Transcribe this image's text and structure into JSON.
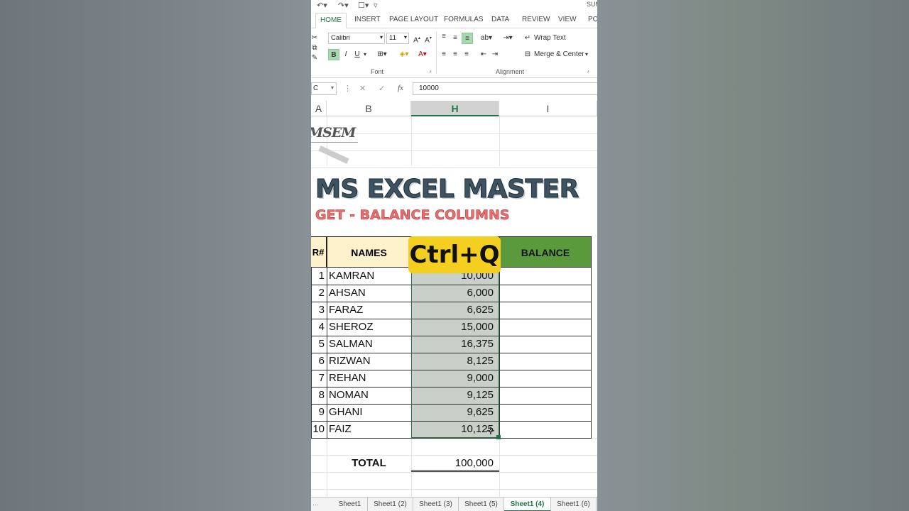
{
  "ribbon": {
    "tabs": [
      "HOME",
      "INSERT",
      "PAGE LAYOUT",
      "FORMULAS",
      "DATA",
      "REVIEW",
      "VIEW",
      "PO"
    ],
    "title_fragment": "SUM",
    "font_name": "Calibri",
    "font_size": "11",
    "wrap_text": "Wrap Text",
    "merge_center": "Merge & Center",
    "group_font": "Font",
    "group_alignment": "Alignment"
  },
  "formula_bar": {
    "name_box": "C",
    "fx": "fx",
    "value": "10000"
  },
  "columns": [
    "A",
    "B",
    "H",
    "I"
  ],
  "heading": {
    "logo_text": "MSEM",
    "title": "MS EXCEL MASTER",
    "subtitle": "GET - BALANCE COLUMNS"
  },
  "table": {
    "headers": {
      "sr": "R#",
      "names": "NAMES",
      "amount": "",
      "balance": "BALANCE"
    },
    "rows": [
      {
        "sr": "1",
        "name": "KAMRAN",
        "amount": "10,000"
      },
      {
        "sr": "2",
        "name": "AHSAN",
        "amount": "6,000"
      },
      {
        "sr": "3",
        "name": "FARAZ",
        "amount": "6,625"
      },
      {
        "sr": "4",
        "name": "SHEROZ",
        "amount": "15,000"
      },
      {
        "sr": "5",
        "name": "SALMAN",
        "amount": "16,375"
      },
      {
        "sr": "6",
        "name": "RIZWAN",
        "amount": "8,125"
      },
      {
        "sr": "7",
        "name": "REHAN",
        "amount": "9,000"
      },
      {
        "sr": "8",
        "name": "NOMAN",
        "amount": "9,125"
      },
      {
        "sr": "9",
        "name": "GHANI",
        "amount": "9,625"
      },
      {
        "sr": "10",
        "name": "FAIZ",
        "amount": "10,125"
      }
    ],
    "total_label": "TOTAL",
    "total_value": "100,000"
  },
  "shortcut_badge": "Ctrl+Q",
  "sheet_tabs": [
    "Sheet1",
    "Sheet1 (2)",
    "Sheet1 (3)",
    "Sheet1 (5)",
    "Sheet1 (4)",
    "Sheet1 (6)"
  ],
  "active_sheet": "Sheet1 (4)",
  "colors": {
    "excel_green": "#217346",
    "header_names_bg": "#fdf2cc",
    "header_balance_bg": "#5b9a3c",
    "badge_yellow": "#f5cf1f",
    "selection_gray": "#c9cfc9"
  }
}
